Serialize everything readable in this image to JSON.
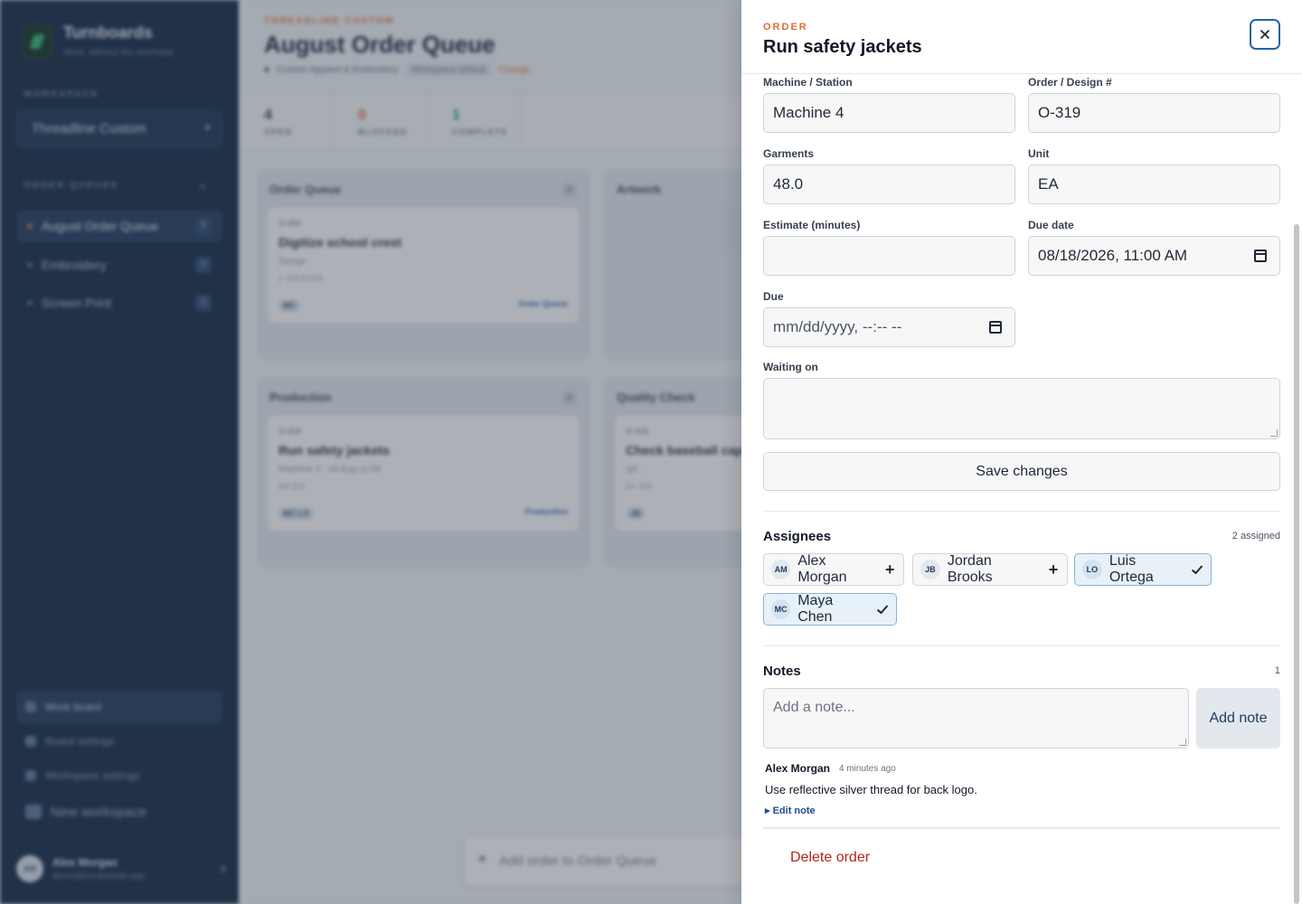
{
  "app": {
    "brand": "Turnboards",
    "tagline": "Work, without the overhead",
    "workspace_label": "WORKSPACE",
    "workspace_value": "Threadline Custom",
    "queues_label": "ORDER QUEUES",
    "queues": [
      {
        "label": "August Order Queue",
        "count": "5"
      },
      {
        "label": "Embroidery",
        "count": "0"
      },
      {
        "label": "Screen Print",
        "count": "0"
      }
    ],
    "nav": [
      {
        "label": "Work board"
      },
      {
        "label": "Board settings"
      },
      {
        "label": "Workspace settings"
      },
      {
        "label": "New workspace"
      }
    ],
    "user": {
      "initials": "AM",
      "name": "Alex Morgan",
      "email": "demo@turnboards.app"
    }
  },
  "board": {
    "crumb": "THREADLINE CUSTOM",
    "title": "August Order Queue",
    "meta": "Custom Apparel & Embroidery",
    "meta_tag": "Workspace default",
    "meta_change": "Change",
    "stats": [
      {
        "n": "4",
        "l": "OPEN",
        "color": "#28374d"
      },
      {
        "n": "0",
        "l": "BLOCKED",
        "color": "#e06c33"
      },
      {
        "n": "1",
        "l": "COMPLETE",
        "color": "#1f9d55"
      }
    ],
    "columns": [
      {
        "title": "Order Queue",
        "count": "1"
      },
      {
        "title": "Artwork",
        "count": ""
      },
      {
        "title": "Production",
        "count": "1"
      },
      {
        "title": "Quality Check",
        "count": ""
      }
    ],
    "cards": [
      {
        "id": "O-302",
        "title": "Digitize school crest",
        "meta": "Design",
        "qty": "1 DESIGN",
        "assignees": "MC",
        "status": "Order Queue"
      },
      {
        "id": "O-319",
        "title": "Run safety jackets",
        "meta": "Machine 4 · 18 Aug 11:00",
        "qty": "48 EA",
        "assignees": "MC LO",
        "status": "Production"
      },
      {
        "id": "O-315",
        "title": "Check baseball cap",
        "meta": "QC",
        "qty": "24 EA",
        "assignees": "JB",
        "status": ""
      }
    ],
    "add_order": "Add order to Order Queue"
  },
  "drawer": {
    "kicker": "ORDER",
    "title": "Run safety jackets",
    "fields": {
      "machine_label": "Machine / Station",
      "machine_value": "Machine 4",
      "order_label": "Order / Design #",
      "order_value": "O-319",
      "garments_label": "Garments",
      "garments_value": "48.0",
      "unit_label": "Unit",
      "unit_value": "EA",
      "estimate_label": "Estimate (minutes)",
      "estimate_value": "",
      "due_date_label": "Due date",
      "due_date_value": "08/18/2026, 11:00 AM",
      "due_label": "Due",
      "due_placeholder": "mm/dd/yyyy, --:-- --",
      "waiting_label": "Waiting on",
      "waiting_value": ""
    },
    "save_label": "Save changes",
    "assignees": {
      "title": "Assignees",
      "meta": "2 assigned",
      "people": [
        {
          "initials": "AM",
          "name": "Alex Morgan",
          "assigned": false
        },
        {
          "initials": "JB",
          "name": "Jordan Brooks",
          "assigned": false
        },
        {
          "initials": "LO",
          "name": "Luis Ortega",
          "assigned": true
        },
        {
          "initials": "MC",
          "name": "Maya Chen",
          "assigned": true
        }
      ]
    },
    "notes": {
      "title": "Notes",
      "count": "1",
      "placeholder": "Add a note...",
      "add_label": "Add note",
      "items": [
        {
          "author": "Alex Morgan",
          "time": "4 minutes ago",
          "body": "Use reflective silver thread for back logo.",
          "edit_label": "▸ Edit note"
        }
      ]
    },
    "delete_label": "Delete order"
  },
  "colors": {
    "accent": "#e06c33",
    "primary": "#2563a8",
    "sidebar": "#0d2340"
  }
}
